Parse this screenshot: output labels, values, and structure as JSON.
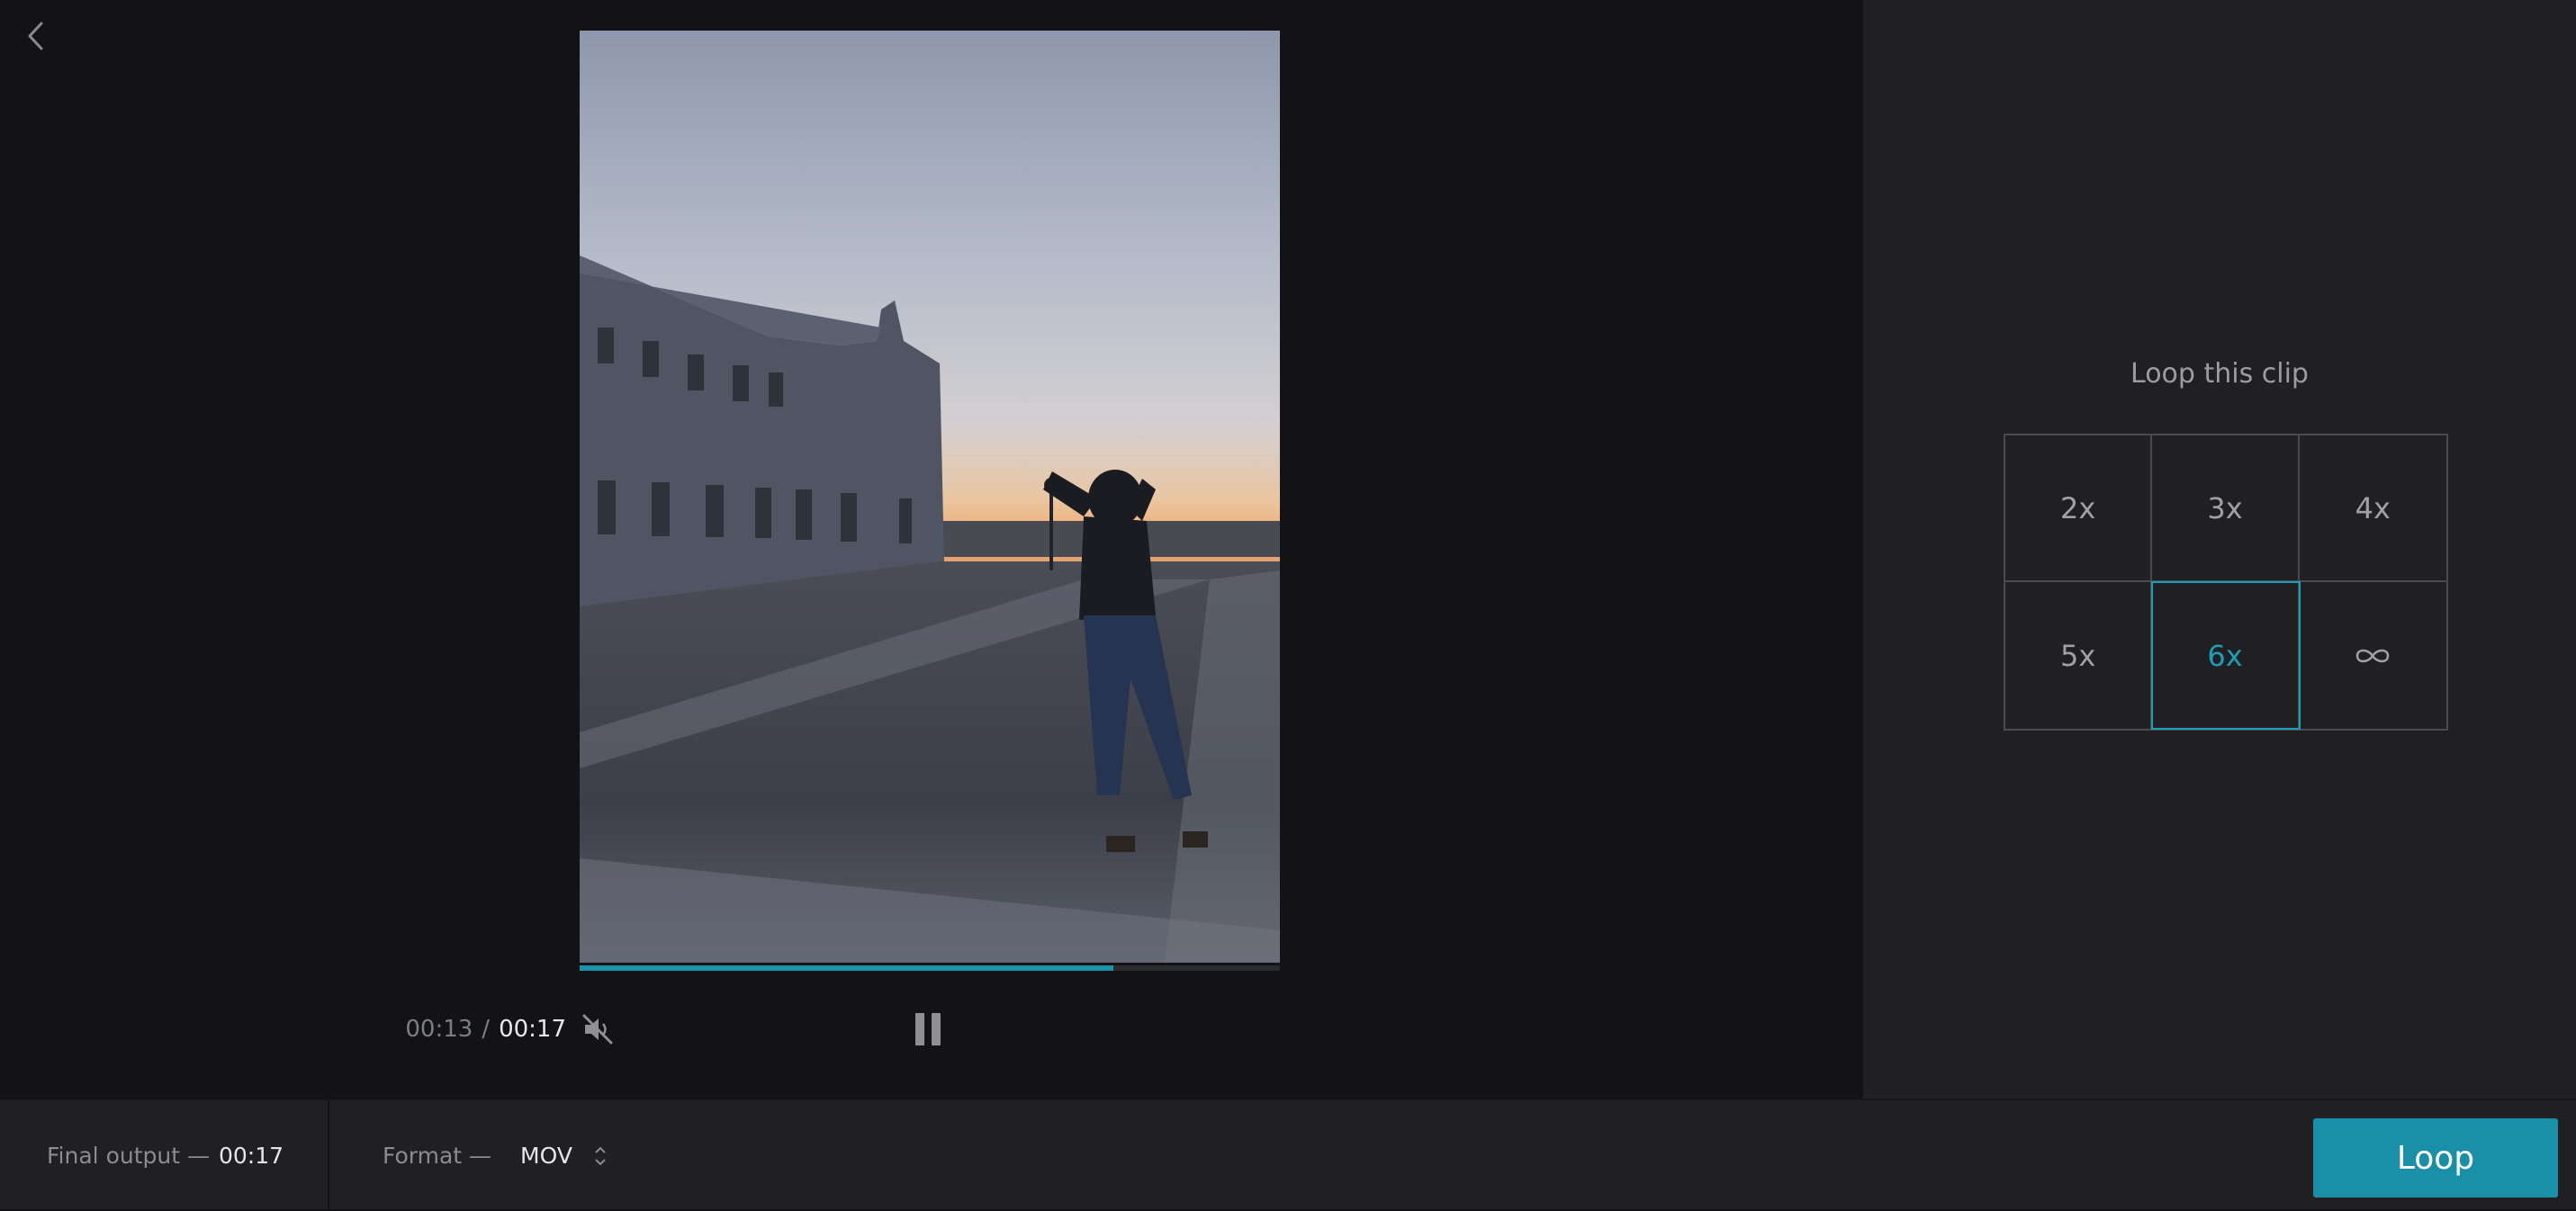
{
  "player": {
    "progress_fraction": 0.762,
    "time_current": "00:13",
    "time_separator": "/",
    "time_total": "00:17",
    "icons": {
      "back": "chevron-left-icon",
      "mute": "speaker-muted-icon",
      "pause": "pause-icon"
    }
  },
  "loop_panel": {
    "title": "Loop this clip",
    "options": [
      {
        "label": "2x",
        "selected": false
      },
      {
        "label": "3x",
        "selected": false
      },
      {
        "label": "4x",
        "selected": false
      },
      {
        "label": "5x",
        "selected": false
      },
      {
        "label": "6x",
        "selected": true
      },
      {
        "label": "",
        "icon": "infinity-icon",
        "selected": false
      }
    ]
  },
  "bottom_bar": {
    "final_output_label": "Final output —",
    "final_output_value": "00:17",
    "format_label": "Format —",
    "format_value": "MOV",
    "format_icon": "sort-arrows-icon",
    "action_label": "Loop"
  },
  "colors": {
    "accent": "#1b93ab",
    "background": "#131315",
    "panel": "#202023",
    "selected": "#1b9cb8"
  }
}
